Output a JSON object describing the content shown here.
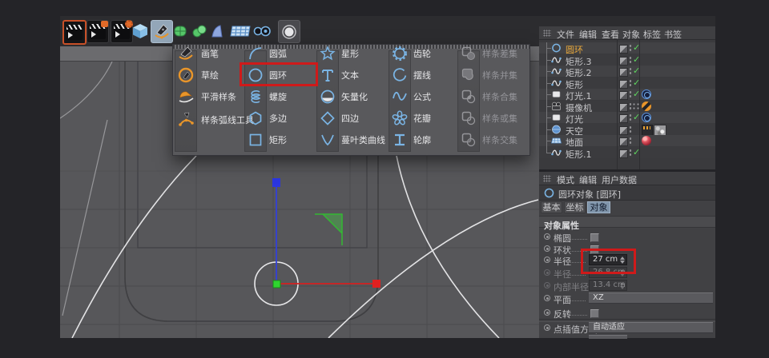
{
  "toolbar": {
    "icons": [
      "render-view",
      "render-picture-viewer",
      "render-settings",
      "add-cube",
      "spline-pen",
      "subdivision-surface",
      "extrude",
      "lattice",
      "array",
      "symmetry",
      "volume"
    ]
  },
  "spline_menu": {
    "tools": [
      "画笔",
      "草绘",
      "平滑样条",
      "样条弧线工具"
    ],
    "column2": [
      "圆弧",
      "圆环",
      "螺旋",
      "多边",
      "矩形"
    ],
    "column3": [
      "星形",
      "文本",
      "矢量化",
      "四边",
      "蔓叶类曲线"
    ],
    "column4": [
      "齿轮",
      "摆线",
      "公式",
      "花瓣",
      "轮廓"
    ],
    "column5": [
      "样条差集",
      "样条并集",
      "样条合集",
      "样条或集",
      "样条交集"
    ]
  },
  "object_manager": {
    "menu": [
      "文件",
      "编辑",
      "查看",
      "对象",
      "标签",
      "书签"
    ],
    "objects": [
      {
        "name": "圆环",
        "selected": true,
        "icon": "circle-spline",
        "enabled": "check"
      },
      {
        "name": "矩形.3",
        "icon": "spline",
        "enabled": "check"
      },
      {
        "name": "矩形.2",
        "icon": "spline",
        "enabled": "check"
      },
      {
        "name": "矩形",
        "icon": "spline",
        "enabled": "check"
      },
      {
        "name": "灯光.1",
        "icon": "light",
        "enabled": "check",
        "tags": [
          "target"
        ]
      },
      {
        "name": "摄像机",
        "icon": "camera",
        "enabled": "crosshair",
        "tags": [
          "camera-protect"
        ]
      },
      {
        "name": "灯光",
        "icon": "light",
        "enabled": "check",
        "tags": [
          "target"
        ]
      },
      {
        "name": "天空",
        "icon": "sky",
        "enabled": "none",
        "tags": [
          "compositing",
          "texture"
        ]
      },
      {
        "name": "地面",
        "icon": "floor",
        "enabled": "none",
        "tags": [
          "material-red"
        ]
      },
      {
        "name": "矩形.1",
        "icon": "spline",
        "enabled": "check"
      }
    ]
  },
  "attribute_manager": {
    "menu": [
      "模式",
      "编辑",
      "用户数据"
    ],
    "title": "圆环对象 [圆环]",
    "tabs": [
      "基本",
      "坐标",
      "对象"
    ],
    "active_tab": "对象",
    "section": "对象属性",
    "properties": {
      "ellipse_label": "椭圆",
      "ring_label": "环状",
      "radius_label": "半径",
      "radius_value": "27 cm",
      "radius2_label": "半径",
      "radius2_value": "26.8 cm",
      "inner_radius_label": "内部半径",
      "inner_radius_value": "13.4 cm",
      "plane_label": "平面",
      "plane_value": "XZ",
      "reverse_label": "反转",
      "interpolation_label": "点插值方式",
      "interpolation_value": "自动适应"
    }
  },
  "colors": {
    "highlight_red": "#cf1a1a",
    "selection_orange": "#e8a83c",
    "icon_blue": "#7ab4e4",
    "tool_orange": "#e8952a",
    "axis_x_red": "#e02020",
    "axis_y_green": "#2fd52f",
    "axis_z_blue": "#2b36e0",
    "enabled_green": "#5fd75f"
  }
}
